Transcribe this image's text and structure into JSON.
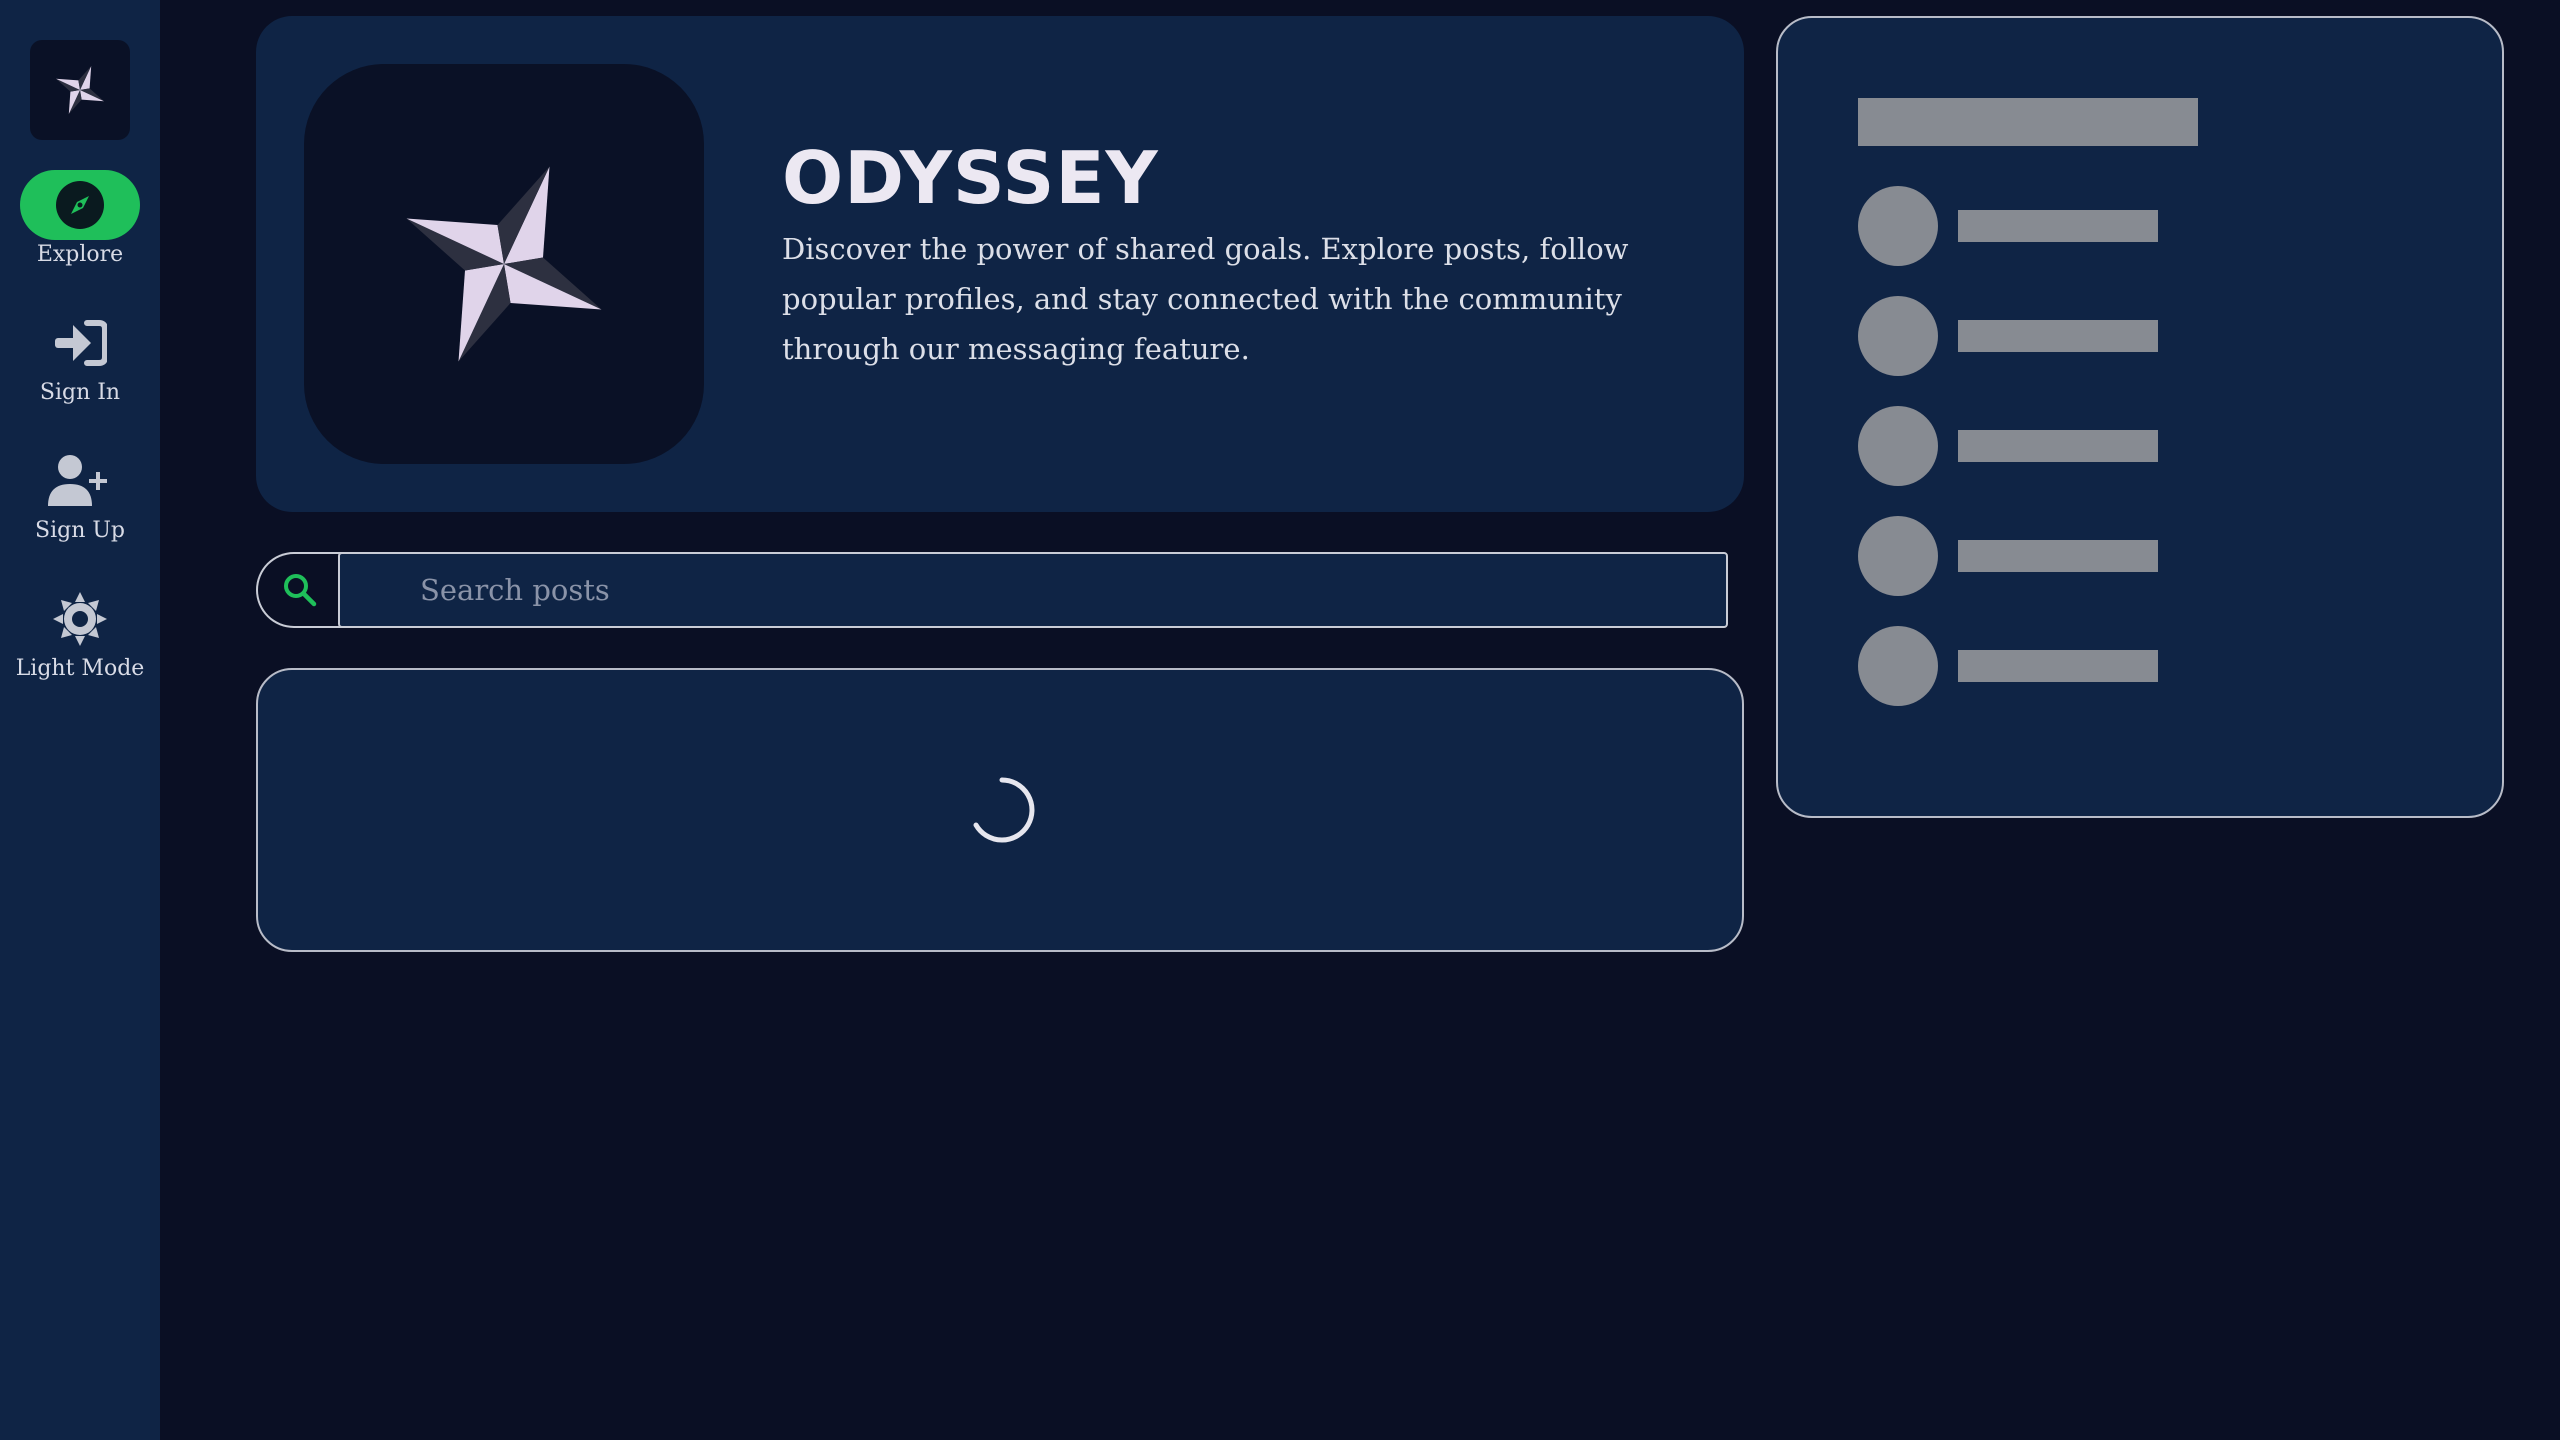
{
  "app": {
    "name": "ODYSSEY",
    "description": "Discover the power of shared goals. Explore posts, follow popular profiles, and stay connected with the community through our messaging feature."
  },
  "sidebar": {
    "logo_icon": "pinwheel-star-icon",
    "items": [
      {
        "label": "Explore",
        "icon": "compass-icon",
        "active": true
      },
      {
        "label": "Sign In",
        "icon": "sign-in-icon",
        "active": false
      },
      {
        "label": "Sign Up",
        "icon": "user-plus-icon",
        "active": false
      },
      {
        "label": "Light Mode",
        "icon": "sun-icon",
        "active": false
      }
    ]
  },
  "search": {
    "placeholder": "Search posts",
    "value": "",
    "icon": "search-icon"
  },
  "posts": {
    "state": "loading",
    "icon": "spinner-icon"
  },
  "side_panel": {
    "state": "loading-skeleton",
    "skeleton_rows": 5
  },
  "colors": {
    "background": "#0a0f24",
    "panel": "#0f2445",
    "accent": "#1fbf5a",
    "skeleton": "#878b92",
    "star_light": "#e0d4ea",
    "star_dark": "#2d3040"
  }
}
